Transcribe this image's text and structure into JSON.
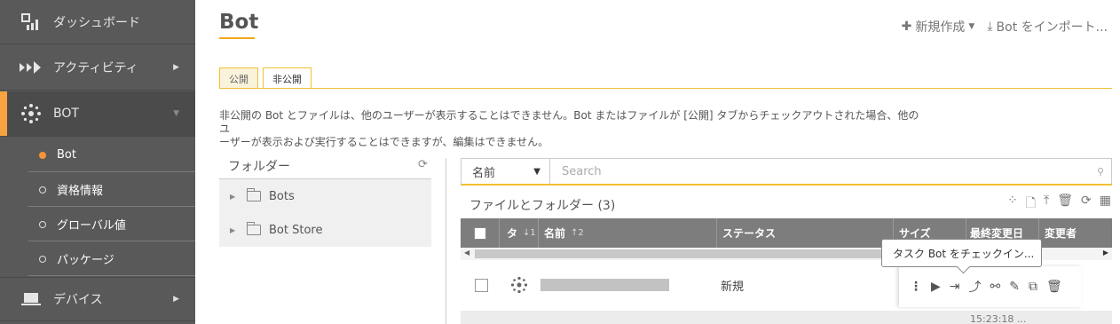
{
  "sidebar": {
    "items": [
      {
        "label": "ダッシュボード",
        "icon": "dashboard-icon"
      },
      {
        "label": "アクティビティ",
        "icon": "activity-icon"
      },
      {
        "label": "BOT",
        "icon": "bot-icon"
      },
      {
        "label": "デバイス",
        "icon": "device-icon"
      }
    ],
    "sub_items": [
      {
        "label": "Bot",
        "active": true
      },
      {
        "label": "資格情報"
      },
      {
        "label": "グローバル値"
      },
      {
        "label": "パッケージ"
      }
    ],
    "accent_color": "#f7a440"
  },
  "header": {
    "title": "Bot",
    "new_label": "新規作成",
    "import_label": "Bot をインポート..."
  },
  "tabs": [
    {
      "label": "公開"
    },
    {
      "label": "非公開"
    }
  ],
  "description": {
    "line1": "非公開の Bot とファイルは、他のユーザーが表示することはできません。Bot またはファイルが [公開] タブからチェックアウトされた場合、他のユ",
    "line2": "ーザーが表示および実行することはできますが、編集はできません。"
  },
  "folders": {
    "title": "フォルダー",
    "items": [
      {
        "label": "Bots"
      },
      {
        "label": "Bot Store"
      }
    ]
  },
  "search": {
    "selected": "名前",
    "placeholder": "Search"
  },
  "files": {
    "title": "ファイルとフォルダー (3)",
    "columns": [
      "タ",
      "名前",
      "ステータス",
      "サイズ",
      "最終変更日",
      "変更者"
    ],
    "type_sort": "↓1",
    "name_sort": "↑2",
    "rows": [
      {
        "status": "新規"
      }
    ],
    "row2_time": "15:23:18 ..."
  },
  "tooltip": "タスク Bot をチェックイン..."
}
